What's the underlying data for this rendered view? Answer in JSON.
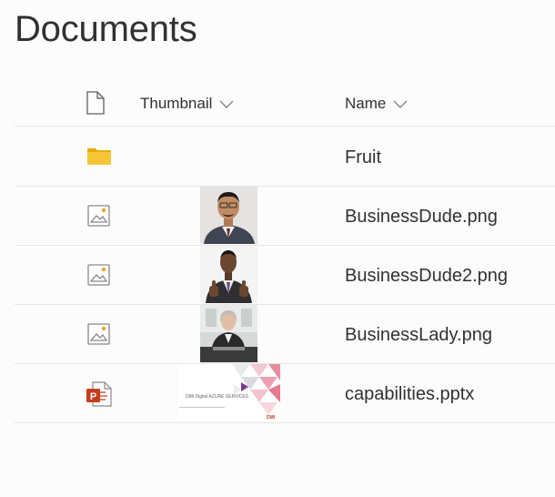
{
  "page": {
    "title": "Documents"
  },
  "columns": {
    "thumbnail": "Thumbnail",
    "name": "Name"
  },
  "rows": [
    {
      "name": "Fruit",
      "type": "folder",
      "icon": "folder-icon"
    },
    {
      "name": "BusinessDude.png",
      "type": "image",
      "icon": "image-file-icon"
    },
    {
      "name": "BusinessDude2.png",
      "type": "image",
      "icon": "image-file-icon"
    },
    {
      "name": "BusinessLady.png",
      "type": "image",
      "icon": "image-file-icon"
    },
    {
      "name": "capabilities.pptx",
      "type": "powerpoint",
      "icon": "powerpoint-file-icon"
    }
  ],
  "pptx_thumbnail": {
    "heading": "DMI Digital AZURE SERVICES",
    "logo": "DMI"
  },
  "colors": {
    "folder": "#f5c638",
    "powerpoint": "#c43e1c",
    "divider": "#e8e6e4"
  }
}
